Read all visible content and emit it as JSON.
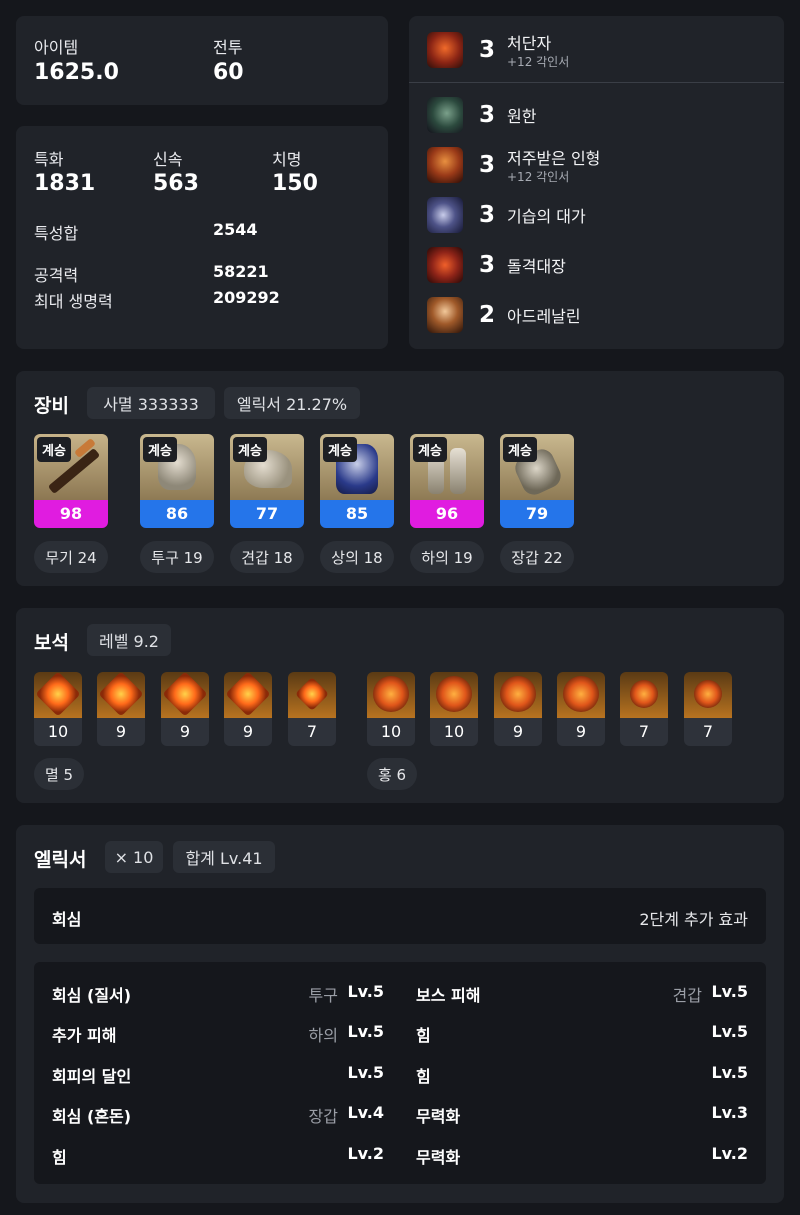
{
  "summary": {
    "item_label": "아이템",
    "item_value": "1625.0",
    "combat_label": "전투",
    "combat_value": "60"
  },
  "stats": {
    "crit_label": "특화",
    "crit_value": "1831",
    "swift_label": "신속",
    "swift_value": "563",
    "fatal_label": "치명",
    "fatal_value": "150",
    "sum_label": "특성합",
    "sum_value": "2544",
    "atk_label": "공격력",
    "atk_value": "58221",
    "hp_label": "최대 생명력",
    "hp_value": "209292"
  },
  "engravings": [
    {
      "level": "3",
      "name": "처단자",
      "sub": "+12 각인서",
      "icon": "executioner-icon",
      "color": "#b5402a"
    },
    {
      "level": "3",
      "name": "원한",
      "sub": "",
      "icon": "grudge-icon",
      "color": "#3d5a4c"
    },
    {
      "level": "3",
      "name": "저주받은 인형",
      "sub": "+12 각인서",
      "icon": "cursed-doll-icon",
      "color": "#8a3a1c"
    },
    {
      "level": "3",
      "name": "기습의 대가",
      "sub": "",
      "icon": "master-ambush-icon",
      "color": "#4a4f7a"
    },
    {
      "level": "3",
      "name": "돌격대장",
      "sub": "",
      "icon": "raid-captain-icon",
      "color": "#8f2a1e"
    },
    {
      "level": "2",
      "name": "아드레날린",
      "sub": "",
      "icon": "adrenaline-icon",
      "color": "#8a5a2a"
    }
  ],
  "equipment": {
    "title": "장비",
    "chip1": "사멸 333333",
    "chip2": "엘릭서 21.27%",
    "items": [
      {
        "tag": "계승",
        "quality": "98",
        "label": "무기 24",
        "bar_color": "#e01ce0",
        "icon": "sword-icon"
      },
      {
        "tag": "계승",
        "quality": "86",
        "label": "투구 19",
        "bar_color": "#2575ea",
        "icon": "helmet-icon"
      },
      {
        "tag": "계승",
        "quality": "77",
        "label": "견갑 18",
        "bar_color": "#2575ea",
        "icon": "shoulder-icon"
      },
      {
        "tag": "계승",
        "quality": "85",
        "label": "상의 18",
        "bar_color": "#2575ea",
        "icon": "chest-armor-icon"
      },
      {
        "tag": "계승",
        "quality": "96",
        "label": "하의 19",
        "bar_color": "#e01ce0",
        "icon": "leg-armor-icon"
      },
      {
        "tag": "계승",
        "quality": "79",
        "label": "장갑 22",
        "bar_color": "#2575ea",
        "icon": "gloves-icon"
      }
    ]
  },
  "gems": {
    "title": "보석",
    "level_chip": "레벨 9.2",
    "left": [
      "10",
      "9",
      "9",
      "9",
      "7"
    ],
    "right": [
      "10",
      "10",
      "9",
      "9",
      "7",
      "7"
    ],
    "left_label": "멸 5",
    "right_label": "홍 6"
  },
  "elixir": {
    "title": "엘릭서",
    "chip1": "× 10",
    "chip2": "합계 Lv.41",
    "bonus_name": "회심",
    "bonus_desc": "2단계 추가 효과",
    "left": [
      {
        "name": "회심 (질서)",
        "part": "투구",
        "lv": "Lv.5"
      },
      {
        "name": "추가 피해",
        "part": "하의",
        "lv": "Lv.5"
      },
      {
        "name": "회피의 달인",
        "part": "",
        "lv": "Lv.5"
      },
      {
        "name": "회심 (혼돈)",
        "part": "장갑",
        "lv": "Lv.4"
      },
      {
        "name": "힘",
        "part": "",
        "lv": "Lv.2"
      }
    ],
    "right": [
      {
        "name": "보스 피해",
        "part": "견갑",
        "lv": "Lv.5"
      },
      {
        "name": "힘",
        "part": "",
        "lv": "Lv.5"
      },
      {
        "name": "힘",
        "part": "",
        "lv": "Lv.5"
      },
      {
        "name": "무력화",
        "part": "",
        "lv": "Lv.3"
      },
      {
        "name": "무력화",
        "part": "",
        "lv": "Lv.2"
      }
    ]
  }
}
